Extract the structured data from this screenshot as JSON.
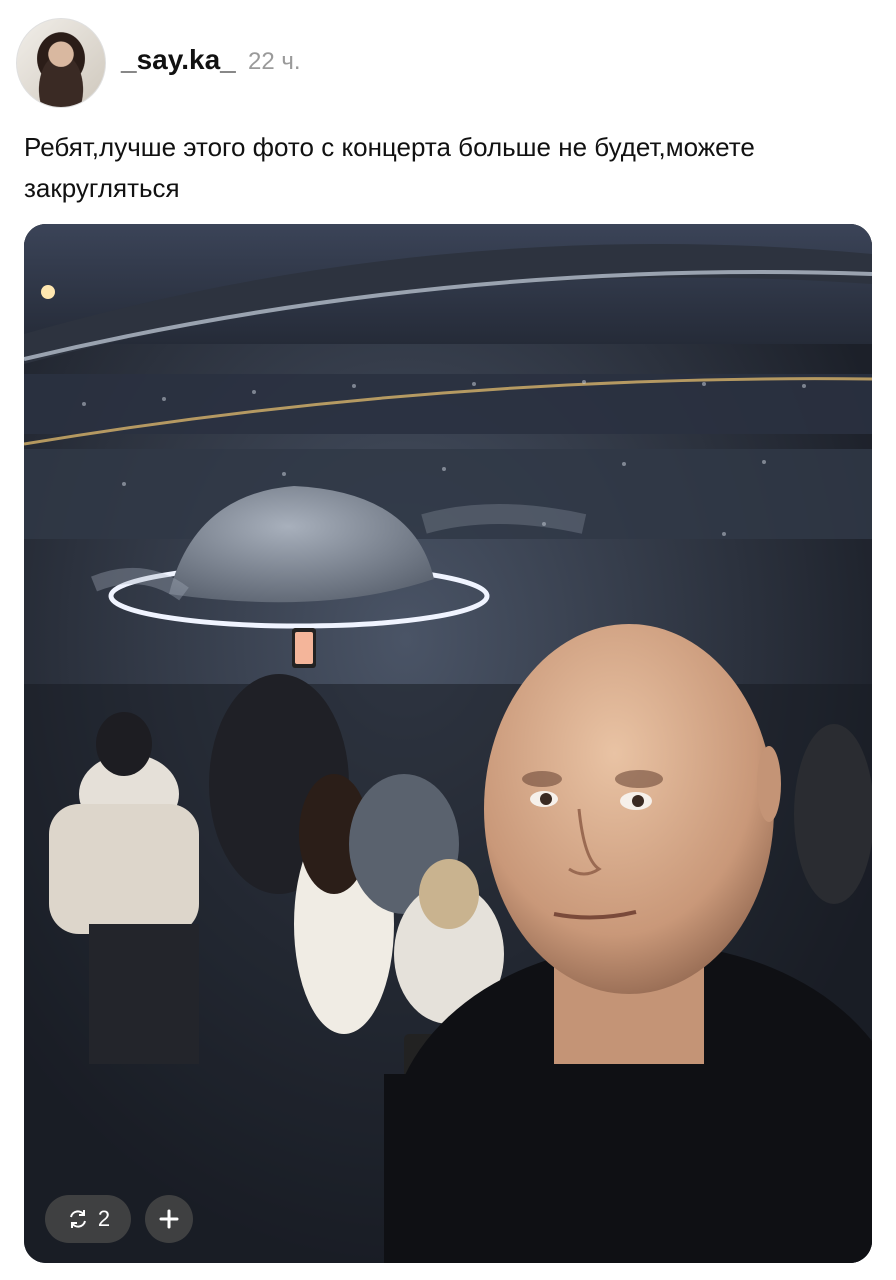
{
  "post": {
    "username": "_say.ka_",
    "time": "22 ч.",
    "text": "Ребят,лучше этого фото с концерта больше не будет,можете закругляться"
  },
  "media": {
    "repost_count": "2",
    "repost_icon": "repost-icon",
    "add_icon": "plus-icon"
  },
  "colors": {
    "text": "#111111",
    "muted": "#9a9a9a",
    "pill_bg": "#464646"
  }
}
